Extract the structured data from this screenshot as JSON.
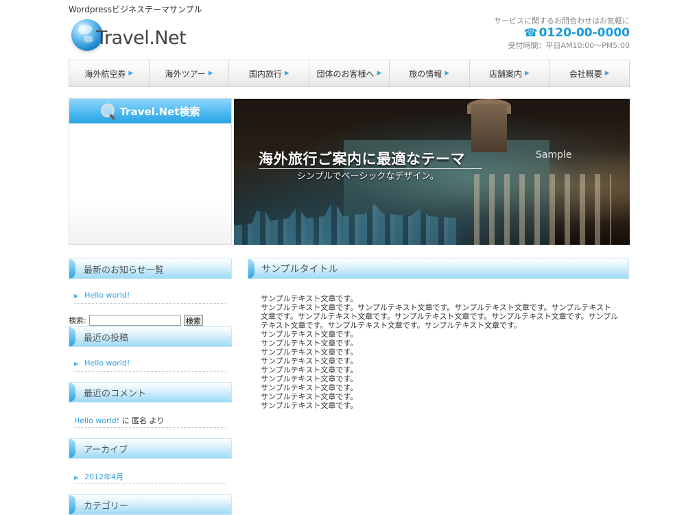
{
  "header": {
    "tagline": "Wordpressビジネステーマサンプル",
    "logo_text": "Travel.Net",
    "contact_note": "サービスに関するお問合わせはお気軽に",
    "phone": "0120-00-0000",
    "hours": "受付時間：平日AM10:00〜PM5:00"
  },
  "nav": {
    "items": [
      "海外航空券",
      "海外ツアー",
      "国内旅行",
      "団体のお客様へ",
      "旅の情報",
      "店舗案内",
      "会社概要"
    ]
  },
  "search_panel": {
    "title": "Travel.Net検索"
  },
  "hero": {
    "title": "海外旅行ご案内に最適なテーマ",
    "subtitle": "シンプルでベーシックなデザイン。",
    "sample": "Sample"
  },
  "sidebar": {
    "news": {
      "title": "最新のお知らせ一覧",
      "items": [
        "Hello world!"
      ]
    },
    "search": {
      "label": "検索:",
      "value": "",
      "button": "検索"
    },
    "recent_posts": {
      "title": "最近の投稿",
      "items": [
        "Hello world!"
      ]
    },
    "recent_comments": {
      "title": "最近のコメント",
      "link": "Hello world!",
      "text": " に 匿名 より"
    },
    "archive": {
      "title": "アーカイブ",
      "items": [
        "2012年4月"
      ]
    },
    "category": {
      "title": "カテゴリー"
    }
  },
  "main": {
    "title": "サンプルタイトル",
    "paragraphs": [
      "サンプルテキスト文章です。",
      "サンプルテキスト文章です。サンプルテキスト文章です。サンプルテキスト文章です。サンプルテキスト文章です。サンプルテキスト文章です。サンプルテキスト文章です。サンプルテキスト文章です。サンプルテキスト文章です。サンプルテキスト文章です。サンプルテキスト文章です。",
      "サンプルテキスト文章です。",
      "サンプルテキスト文章です。",
      "サンプルテキスト文章です。",
      "サンプルテキスト文章です。",
      "サンプルテキスト文章です。",
      "サンプルテキスト文章です。",
      "サンプルテキスト文章です。",
      "サンプルテキスト文章です。",
      "サンプルテキスト文章です。"
    ]
  },
  "colors": {
    "accent": "#2c9fe0",
    "phone": "#1a9ad8"
  }
}
